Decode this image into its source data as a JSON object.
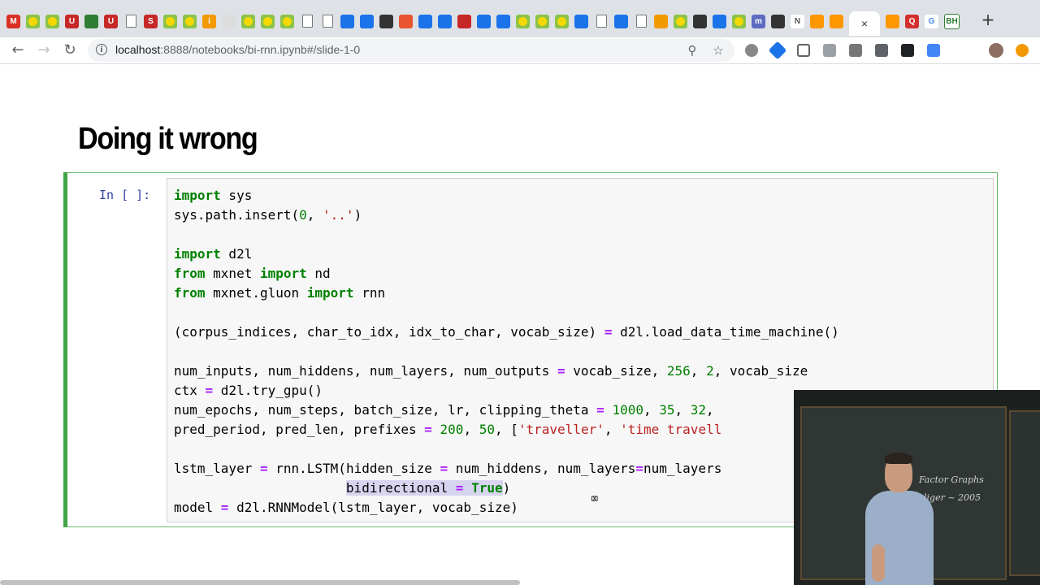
{
  "browser": {
    "new_tab_label": "+",
    "url_host": "localhost",
    "url_rest": ":8888/notebooks/bi-rnn.ipynb#/slide-1-0",
    "info_glyph": "i",
    "tab_glyphs": [
      "M",
      "",
      "",
      "U",
      "",
      "U",
      "",
      "S",
      "",
      "",
      "i",
      "",
      "",
      "",
      "",
      "",
      "",
      "",
      "",
      "",
      "",
      "",
      "",
      "",
      "",
      "",
      "",
      "",
      "",
      "",
      "",
      "",
      "",
      "",
      "",
      "",
      "",
      "",
      "m",
      "",
      "N",
      "",
      "",
      "×",
      "",
      "Q",
      "G",
      "BH"
    ]
  },
  "notebook": {
    "slide_title": "Doing it wrong",
    "cell_prompt": "In [ ]:",
    "code_lines": [
      [
        [
          "kw",
          "import"
        ],
        [
          "t",
          " sys"
        ]
      ],
      [
        [
          "t",
          "sys.path.insert("
        ],
        [
          "num",
          "0"
        ],
        [
          "t",
          ", "
        ],
        [
          "str",
          "'..'"
        ],
        [
          "t",
          ")"
        ]
      ],
      [],
      [
        [
          "kw",
          "import"
        ],
        [
          "t",
          " d2l"
        ]
      ],
      [
        [
          "kw",
          "from"
        ],
        [
          "t",
          " mxnet "
        ],
        [
          "kw",
          "import"
        ],
        [
          "t",
          " nd"
        ]
      ],
      [
        [
          "kw",
          "from"
        ],
        [
          "t",
          " mxnet.gluon "
        ],
        [
          "kw",
          "import"
        ],
        [
          "t",
          " rnn"
        ]
      ],
      [],
      [
        [
          "t",
          "(corpus_indices, char_to_idx, idx_to_char, vocab_size) "
        ],
        [
          "op",
          "="
        ],
        [
          "t",
          " d2l.load_data_time_machine()"
        ]
      ],
      [],
      [
        [
          "t",
          "num_inputs, num_hiddens, num_layers, num_outputs "
        ],
        [
          "op",
          "="
        ],
        [
          "t",
          " vocab_size, "
        ],
        [
          "num",
          "256"
        ],
        [
          "t",
          ", "
        ],
        [
          "num",
          "2"
        ],
        [
          "t",
          ", vocab_size"
        ]
      ],
      [
        [
          "t",
          "ctx "
        ],
        [
          "op",
          "="
        ],
        [
          "t",
          " d2l.try_gpu()"
        ]
      ],
      [
        [
          "t",
          "num_epochs, num_steps, batch_size, lr, clipping_theta "
        ],
        [
          "op",
          "="
        ],
        [
          "t",
          " "
        ],
        [
          "num",
          "1000"
        ],
        [
          "t",
          ", "
        ],
        [
          "num",
          "35"
        ],
        [
          "t",
          ", "
        ],
        [
          "num",
          "32"
        ],
        [
          "t",
          ","
        ]
      ],
      [
        [
          "t",
          "pred_period, pred_len, prefixes "
        ],
        [
          "op",
          "="
        ],
        [
          "t",
          " "
        ],
        [
          "num",
          "200"
        ],
        [
          "t",
          ", "
        ],
        [
          "num",
          "50"
        ],
        [
          "t",
          ", ["
        ],
        [
          "str",
          "'traveller'"
        ],
        [
          "t",
          ", "
        ],
        [
          "str",
          "'time travell"
        ]
      ],
      [],
      [
        [
          "t",
          "lstm_layer "
        ],
        [
          "op",
          "="
        ],
        [
          "t",
          " rnn.LSTM(hidden_size "
        ],
        [
          "op",
          "="
        ],
        [
          "t",
          " num_hiddens, num_layers"
        ],
        [
          "op",
          "="
        ],
        [
          "t",
          "num_layers"
        ]
      ],
      [
        [
          "t",
          "                      "
        ],
        [
          "sel",
          "bidirectional "
        ],
        [
          "selop",
          "="
        ],
        [
          "sel",
          " "
        ],
        [
          "selkw",
          "True"
        ],
        [
          "t",
          ")"
        ]
      ],
      [
        [
          "t",
          "model "
        ],
        [
          "op",
          "="
        ],
        [
          "t",
          " d2l.RNNModel(lstm_layer, vocab_size)"
        ]
      ]
    ]
  },
  "webcam": {
    "chalk_text_1": "Factor Graphs",
    "chalk_text_2": "liger ~ 2005"
  }
}
